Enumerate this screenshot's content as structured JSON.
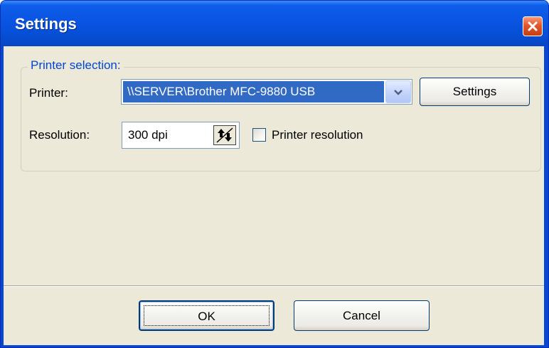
{
  "window": {
    "title": "Settings"
  },
  "printer_selection": {
    "group_label": "Printer selection:",
    "printer_label": "Printer:",
    "printer_value": "\\\\SERVER\\Brother MFC-9880 USB",
    "settings_button": "Settings",
    "resolution_label": "Resolution:",
    "resolution_value": "300 dpi",
    "printer_resolution_label": "Printer resolution",
    "printer_resolution_checked": false
  },
  "footer": {
    "ok_label": "OK",
    "cancel_label": "Cancel"
  },
  "icons": {
    "close": "close-icon",
    "dropdown": "chevron-down-icon",
    "spinner": "spinner-arrows-icon"
  },
  "colors": {
    "titlebar": "#0a54e3",
    "selection": "#316ac5",
    "dialog_face": "#ece9d8",
    "group_label": "#0046d5",
    "close_button": "#e3572a"
  }
}
